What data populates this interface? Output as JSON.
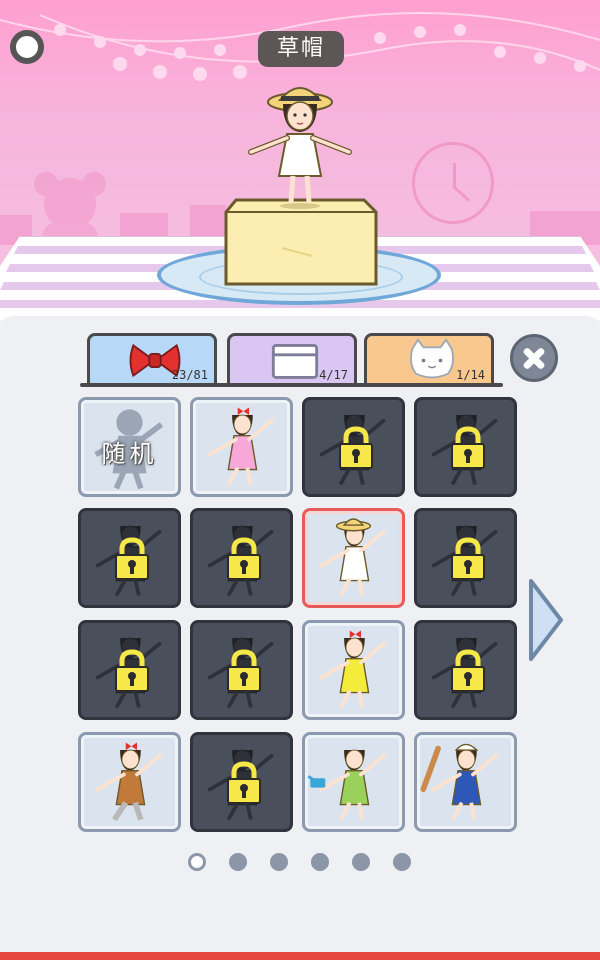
{
  "header": {
    "title": "草帽"
  },
  "tabs": [
    {
      "id": "outfit",
      "icon": "bow-icon",
      "count": "23/81",
      "active": true
    },
    {
      "id": "cake",
      "icon": "box-icon",
      "count": "4/17",
      "active": false
    },
    {
      "id": "pet",
      "icon": "cat-icon",
      "count": "1/14",
      "active": false
    }
  ],
  "grid": {
    "random_label": "随机",
    "tiles": [
      {
        "state": "random"
      },
      {
        "state": "unlocked",
        "outfit": "pink-dress"
      },
      {
        "state": "locked"
      },
      {
        "state": "locked"
      },
      {
        "state": "locked"
      },
      {
        "state": "locked"
      },
      {
        "state": "selected",
        "outfit": "straw-hat-white-dress"
      },
      {
        "state": "locked"
      },
      {
        "state": "locked"
      },
      {
        "state": "locked"
      },
      {
        "state": "unlocked",
        "outfit": "yellow-flower-dress"
      },
      {
        "state": "locked"
      },
      {
        "state": "unlocked",
        "outfit": "brown-shirt-grey-pants"
      },
      {
        "state": "locked"
      },
      {
        "state": "unlocked",
        "outfit": "green-dress-watering-can"
      },
      {
        "state": "unlocked",
        "outfit": "chef-apron-rolling-pin"
      }
    ]
  },
  "pager": {
    "pages": 6,
    "current": 1
  },
  "colors": {
    "accent_red": "#e3473e",
    "stage_pink": "#f7b5dc",
    "locked_tile": "#4a4f5c",
    "selected_border": "#e75a5a",
    "lock_yellow": "#f7e84a"
  }
}
